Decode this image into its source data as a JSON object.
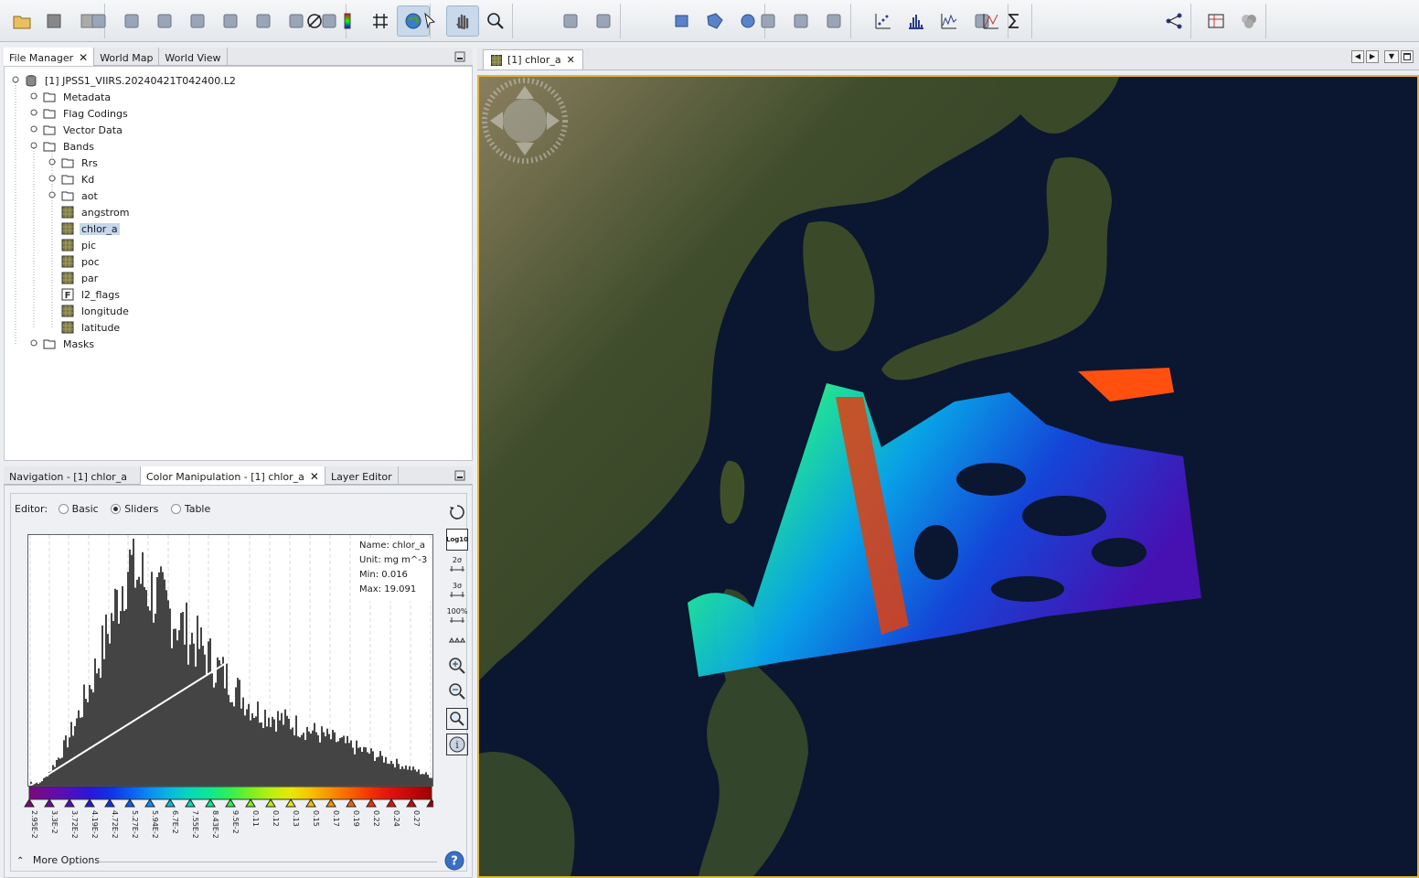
{
  "toolbar": {
    "icons": [
      "open-product-icon",
      "close-product-icon",
      "session-icon",
      "band-maths-icon",
      "subset-icon",
      "mosaic-icon",
      "collocation-icon",
      "graph-builder-icon",
      "reprojection-icon",
      "pixel-geocoding-icon",
      "fingerprint-icon",
      "no-data-icon",
      "color-bar-icon",
      "graticule-icon",
      "world-view-icon",
      "select-tool-icon",
      "pan-tool-icon",
      "zoom-tool-icon",
      "pin-manager-icon",
      "export-icon",
      "rectangle-draw-icon",
      "polygon-draw-icon",
      "ellipse-draw-icon",
      "magic-wand-icon",
      "pin-placing-icon",
      "gcp-placing-icon",
      "scatter-plot-icon",
      "histogram-icon",
      "profile-plot-icon",
      "correlative-plot-icon",
      "statistics-icon",
      "spectrum-icon",
      "graph-icon",
      "layout-icon",
      "rgb-icon"
    ]
  },
  "file_manager": {
    "tabs": [
      {
        "label": "File Manager"
      },
      {
        "label": "World Map"
      },
      {
        "label": "World View"
      }
    ],
    "product": "[1] JPSS1_VIIRS.20240421T042400.L2",
    "folders": [
      "Metadata",
      "Flag Codings",
      "Vector Data",
      "Bands"
    ],
    "band_groups": [
      "Rrs",
      "Kd",
      "aot"
    ],
    "bands": [
      "angstrom",
      "chlor_a",
      "pic",
      "poc",
      "par",
      "l2_flags",
      "longitude",
      "latitude"
    ],
    "masks": "Masks",
    "selected_band": "chlor_a"
  },
  "lower_panel": {
    "tabs": [
      {
        "label": "Navigation - [1] chlor_a"
      },
      {
        "label": "Color Manipulation - [1] chlor_a"
      },
      {
        "label": "Layer Editor"
      }
    ]
  },
  "color_manipulation": {
    "editor_label": "Editor:",
    "modes": [
      {
        "label": "Basic",
        "selected": false
      },
      {
        "label": "Sliders",
        "selected": true
      },
      {
        "label": "Table",
        "selected": false
      }
    ],
    "info": {
      "name": "Name: chlor_a",
      "unit": "Unit: mg m^-3",
      "min": "Min: 0.016",
      "max": "Max: 19.091"
    },
    "side_tools": {
      "log_label": "Log10",
      "sigma2": "2σ",
      "sigma3": "3σ",
      "pct100": "100%"
    },
    "slider_labels": [
      "2.95E-2",
      "3.3E-2",
      "3.72E-2",
      "4.19E-2",
      "4.72E-2",
      "5.27E-2",
      "5.94E-2",
      "6.7E-2",
      "7.55E-2",
      "8.43E-2",
      "9.5E-2",
      "0.11",
      "0.12",
      "0.13",
      "0.15",
      "0.17",
      "0.19",
      "0.22",
      "0.24",
      "0.27",
      "0.31"
    ],
    "slider_colors": [
      "#7a0a7a",
      "#6a0ba0",
      "#4f10c0",
      "#2a16d8",
      "#1030e8",
      "#0a5cf0",
      "#0a8ef0",
      "#08b8e0",
      "#07d8b8",
      "#0ee890",
      "#32f050",
      "#7af020",
      "#b8f010",
      "#e8e808",
      "#f8c000",
      "#f89000",
      "#f86000",
      "#f03000",
      "#e01010",
      "#c00808",
      "#a00000"
    ],
    "more_options": "More Options"
  },
  "image_view": {
    "tab_label": "[1] chlor_a"
  },
  "colors": {
    "selection": "#c5d7ec",
    "view_border": "#e0b43a",
    "ocean": "#0b1630"
  }
}
